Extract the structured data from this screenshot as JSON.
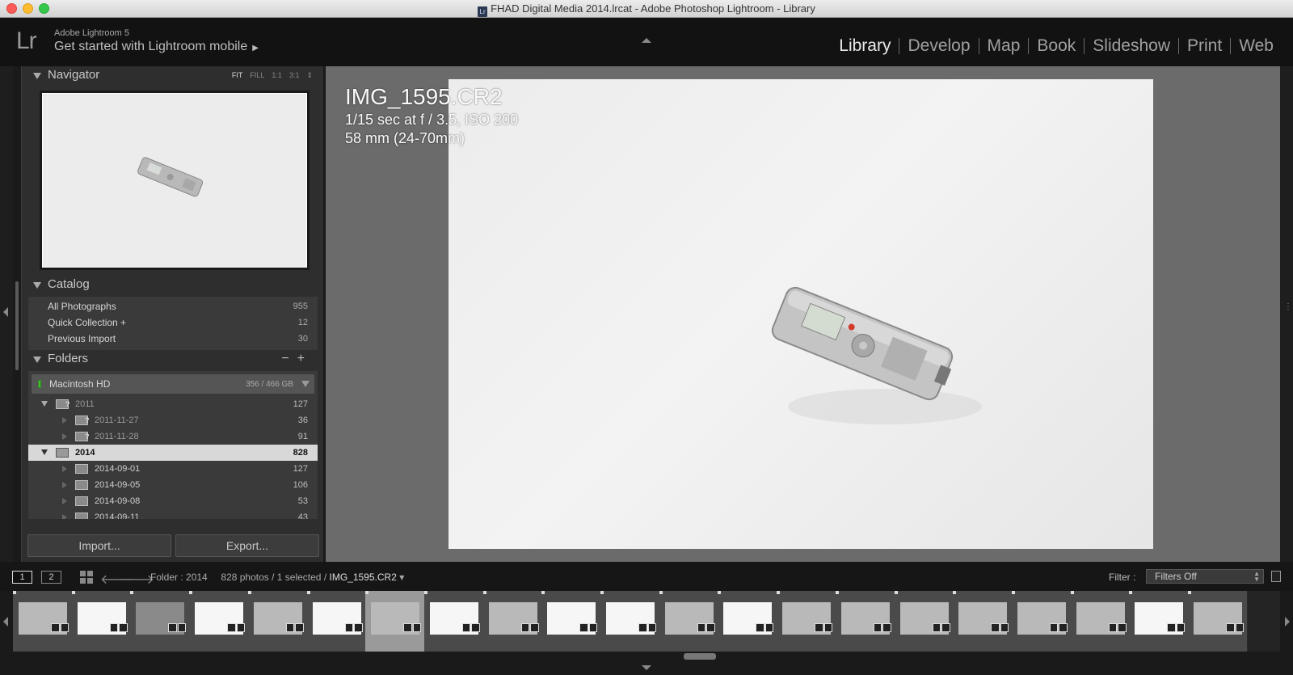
{
  "window": {
    "title": "FHAD Digital Media 2014.lrcat - Adobe Photoshop Lightroom - Library",
    "icon_text": "Lr"
  },
  "identity": {
    "logo": "Lr",
    "version": "Adobe Lightroom 5",
    "mobile_prompt": "Get started with Lightroom mobile"
  },
  "modules": [
    "Library",
    "Develop",
    "Map",
    "Book",
    "Slideshow",
    "Print",
    "Web"
  ],
  "active_module": "Library",
  "navigator": {
    "title": "Navigator",
    "zoom": [
      "FIT",
      "FILL",
      "1:1",
      "3:1"
    ],
    "active_zoom": "FIT"
  },
  "catalog": {
    "title": "Catalog",
    "items": [
      {
        "label": "All Photographs",
        "count": "955"
      },
      {
        "label": "Quick Collection  +",
        "count": "12"
      },
      {
        "label": "Previous Import",
        "count": "30"
      }
    ]
  },
  "folders": {
    "title": "Folders",
    "add": "+",
    "remove": "−",
    "volume": {
      "name": "Macintosh HD",
      "size": "356 / 466 GB"
    },
    "items": [
      {
        "name": "2011",
        "count": "127",
        "level": 0,
        "expanded": true,
        "missing": true
      },
      {
        "name": "2011-11-27",
        "count": "36",
        "level": 1,
        "missing": true
      },
      {
        "name": "2011-11-28",
        "count": "91",
        "level": 1,
        "missing": true
      },
      {
        "name": "2014",
        "count": "828",
        "level": 0,
        "expanded": true,
        "selected": true
      },
      {
        "name": "2014-09-01",
        "count": "127",
        "level": 1
      },
      {
        "name": "2014-09-05",
        "count": "106",
        "level": 1
      },
      {
        "name": "2014-09-08",
        "count": "53",
        "level": 1
      },
      {
        "name": "2014-09-11",
        "count": "43",
        "level": 1
      }
    ]
  },
  "buttons": {
    "import": "Import...",
    "export": "Export..."
  },
  "photo_info": {
    "filename": "IMG_1595.CR2",
    "exposure": "1/15 sec at f / 3.5, ISO 200",
    "lens": "58 mm (24-70mm)"
  },
  "toolbar": {
    "screen1": "1",
    "screen2": "2",
    "folder_label": "Folder : 2014",
    "count_text": "828 photos / 1 selected /",
    "current_file": "IMG_1595.CR2",
    "filter_label": "Filter :",
    "filter_value": "Filters Off"
  },
  "filmstrip": {
    "thumbs": [
      "mid",
      "bright",
      "dark",
      "bright",
      "mid",
      "bright",
      "mid",
      "bright",
      "mid",
      "bright",
      "bright",
      "mid",
      "bright",
      "mid",
      "mid",
      "mid",
      "mid",
      "mid",
      "mid",
      "bright",
      "mid"
    ],
    "selected_index": 6
  }
}
